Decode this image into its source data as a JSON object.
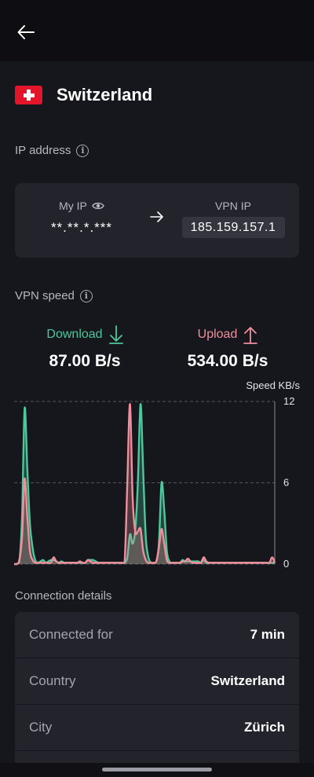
{
  "header": {
    "back_icon": "arrow-left-icon"
  },
  "location": {
    "country": "Switzerland",
    "flag_icon": "swiss-flag-icon"
  },
  "ip": {
    "section_label": "IP address",
    "my_ip_label": "My IP",
    "my_ip_value": "**.**.*.***",
    "vpn_ip_label": "VPN IP",
    "vpn_ip_value": "185.159.157.1"
  },
  "speed": {
    "section_label": "VPN speed",
    "download_label": "Download",
    "download_value": "87.00 B/s",
    "upload_label": "Upload",
    "upload_value": "534.00 B/s",
    "colors": {
      "download": "#4ec79b",
      "upload": "#f08f9c"
    }
  },
  "chart_data": {
    "type": "area",
    "ylabel": "Speed KB/s",
    "ylim": [
      0,
      12
    ],
    "yticks": [
      "12",
      "6",
      "0"
    ],
    "x": [
      0,
      1,
      2,
      3,
      4,
      5,
      6,
      7,
      8,
      9,
      10,
      11,
      12,
      13,
      14,
      15,
      16,
      17,
      18,
      19,
      20,
      21,
      22,
      23,
      24,
      25,
      26,
      27,
      28,
      29,
      30,
      31,
      32,
      33,
      34,
      35,
      36,
      37,
      38,
      39,
      40,
      41,
      42,
      43,
      44,
      45,
      46,
      47,
      48,
      49,
      50,
      51,
      52,
      53,
      54,
      55,
      56,
      57,
      58,
      59,
      60,
      61,
      62,
      63,
      64,
      65,
      66,
      67,
      68,
      69,
      70,
      71,
      72,
      73,
      74,
      75,
      76,
      77,
      78,
      79,
      80,
      81,
      82,
      83,
      84,
      85,
      86,
      87,
      88,
      89,
      90,
      91,
      92,
      93,
      94,
      95,
      96,
      97,
      98,
      99
    ],
    "series": [
      {
        "values": [
          0,
          0,
          0.2,
          3.5,
          11.5,
          7,
          3,
          1.2,
          0.3,
          0.1,
          0.2,
          0.3,
          0.1,
          0.2,
          0.3,
          0.3,
          0.2,
          0.1,
          0.2,
          0.1,
          0.1,
          0.1,
          0.1,
          0.1,
          0.1,
          0.1,
          0.1,
          0.1,
          0.3,
          0.3,
          0.3,
          0.2,
          0.1,
          0.1,
          0.1,
          0.1,
          0.1,
          0.1,
          0.1,
          0.1,
          0.1,
          0.1,
          0.1,
          0.5,
          2.2,
          1.5,
          2.5,
          6,
          11.8,
          7,
          2,
          0.5,
          0.1,
          0.1,
          0.2,
          1.5,
          6,
          4,
          1,
          0.2,
          0.1,
          0.1,
          0.1,
          0.1,
          0.3,
          0.2,
          0.2,
          0.2,
          0.2,
          0.2,
          0.2,
          0.1,
          0.3,
          0.1,
          0.1,
          0.1,
          0.1,
          0.1,
          0.1,
          0.1,
          0.1,
          0.1,
          0.1,
          0.1,
          0.1,
          0.1,
          0.1,
          0.1,
          0.1,
          0.1,
          0.1,
          0.1,
          0.1,
          0.1,
          0.1,
          0.1,
          0.1,
          0.1,
          0.1,
          0.1
        ]
      },
      {
        "values": [
          0,
          0,
          0.3,
          2,
          6.3,
          3.5,
          1,
          0.3,
          0.1,
          0.1,
          0.1,
          0.1,
          0.1,
          0.1,
          0.1,
          0.5,
          0.2,
          0.1,
          0.1,
          0.1,
          0.1,
          0.1,
          0.1,
          0.1,
          0.1,
          0.2,
          0.1,
          0.1,
          0.3,
          0.2,
          0.1,
          0.1,
          0.1,
          0.1,
          0.1,
          0.1,
          0.1,
          0.1,
          0.1,
          0.1,
          0.1,
          0.1,
          0.2,
          6,
          11.8,
          5,
          2.4,
          2.4,
          2.6,
          1,
          0.3,
          0.1,
          0.1,
          0.1,
          0.2,
          1.2,
          2.6,
          1.5,
          0.3,
          0.1,
          0.1,
          0.1,
          0.1,
          0.1,
          0.2,
          0.2,
          0.4,
          0.2,
          0.1,
          0.1,
          0.1,
          0.1,
          0.5,
          0.2,
          0.1,
          0.1,
          0.1,
          0.1,
          0.1,
          0.1,
          0.1,
          0.1,
          0.1,
          0.1,
          0.1,
          0.1,
          0.1,
          0.1,
          0.1,
          0.1,
          0.1,
          0.1,
          0.1,
          0.1,
          0.1,
          0.1,
          0.1,
          0.1,
          0.5,
          0.1
        ]
      }
    ],
    "grid": true
  },
  "details": {
    "section_label": "Connection details",
    "rows": [
      {
        "key": "Connected for",
        "value": "7 min"
      },
      {
        "key": "Country",
        "value": "Switzerland"
      },
      {
        "key": "City",
        "value": "Zürich"
      },
      {
        "key": "",
        "value": ""
      }
    ]
  }
}
